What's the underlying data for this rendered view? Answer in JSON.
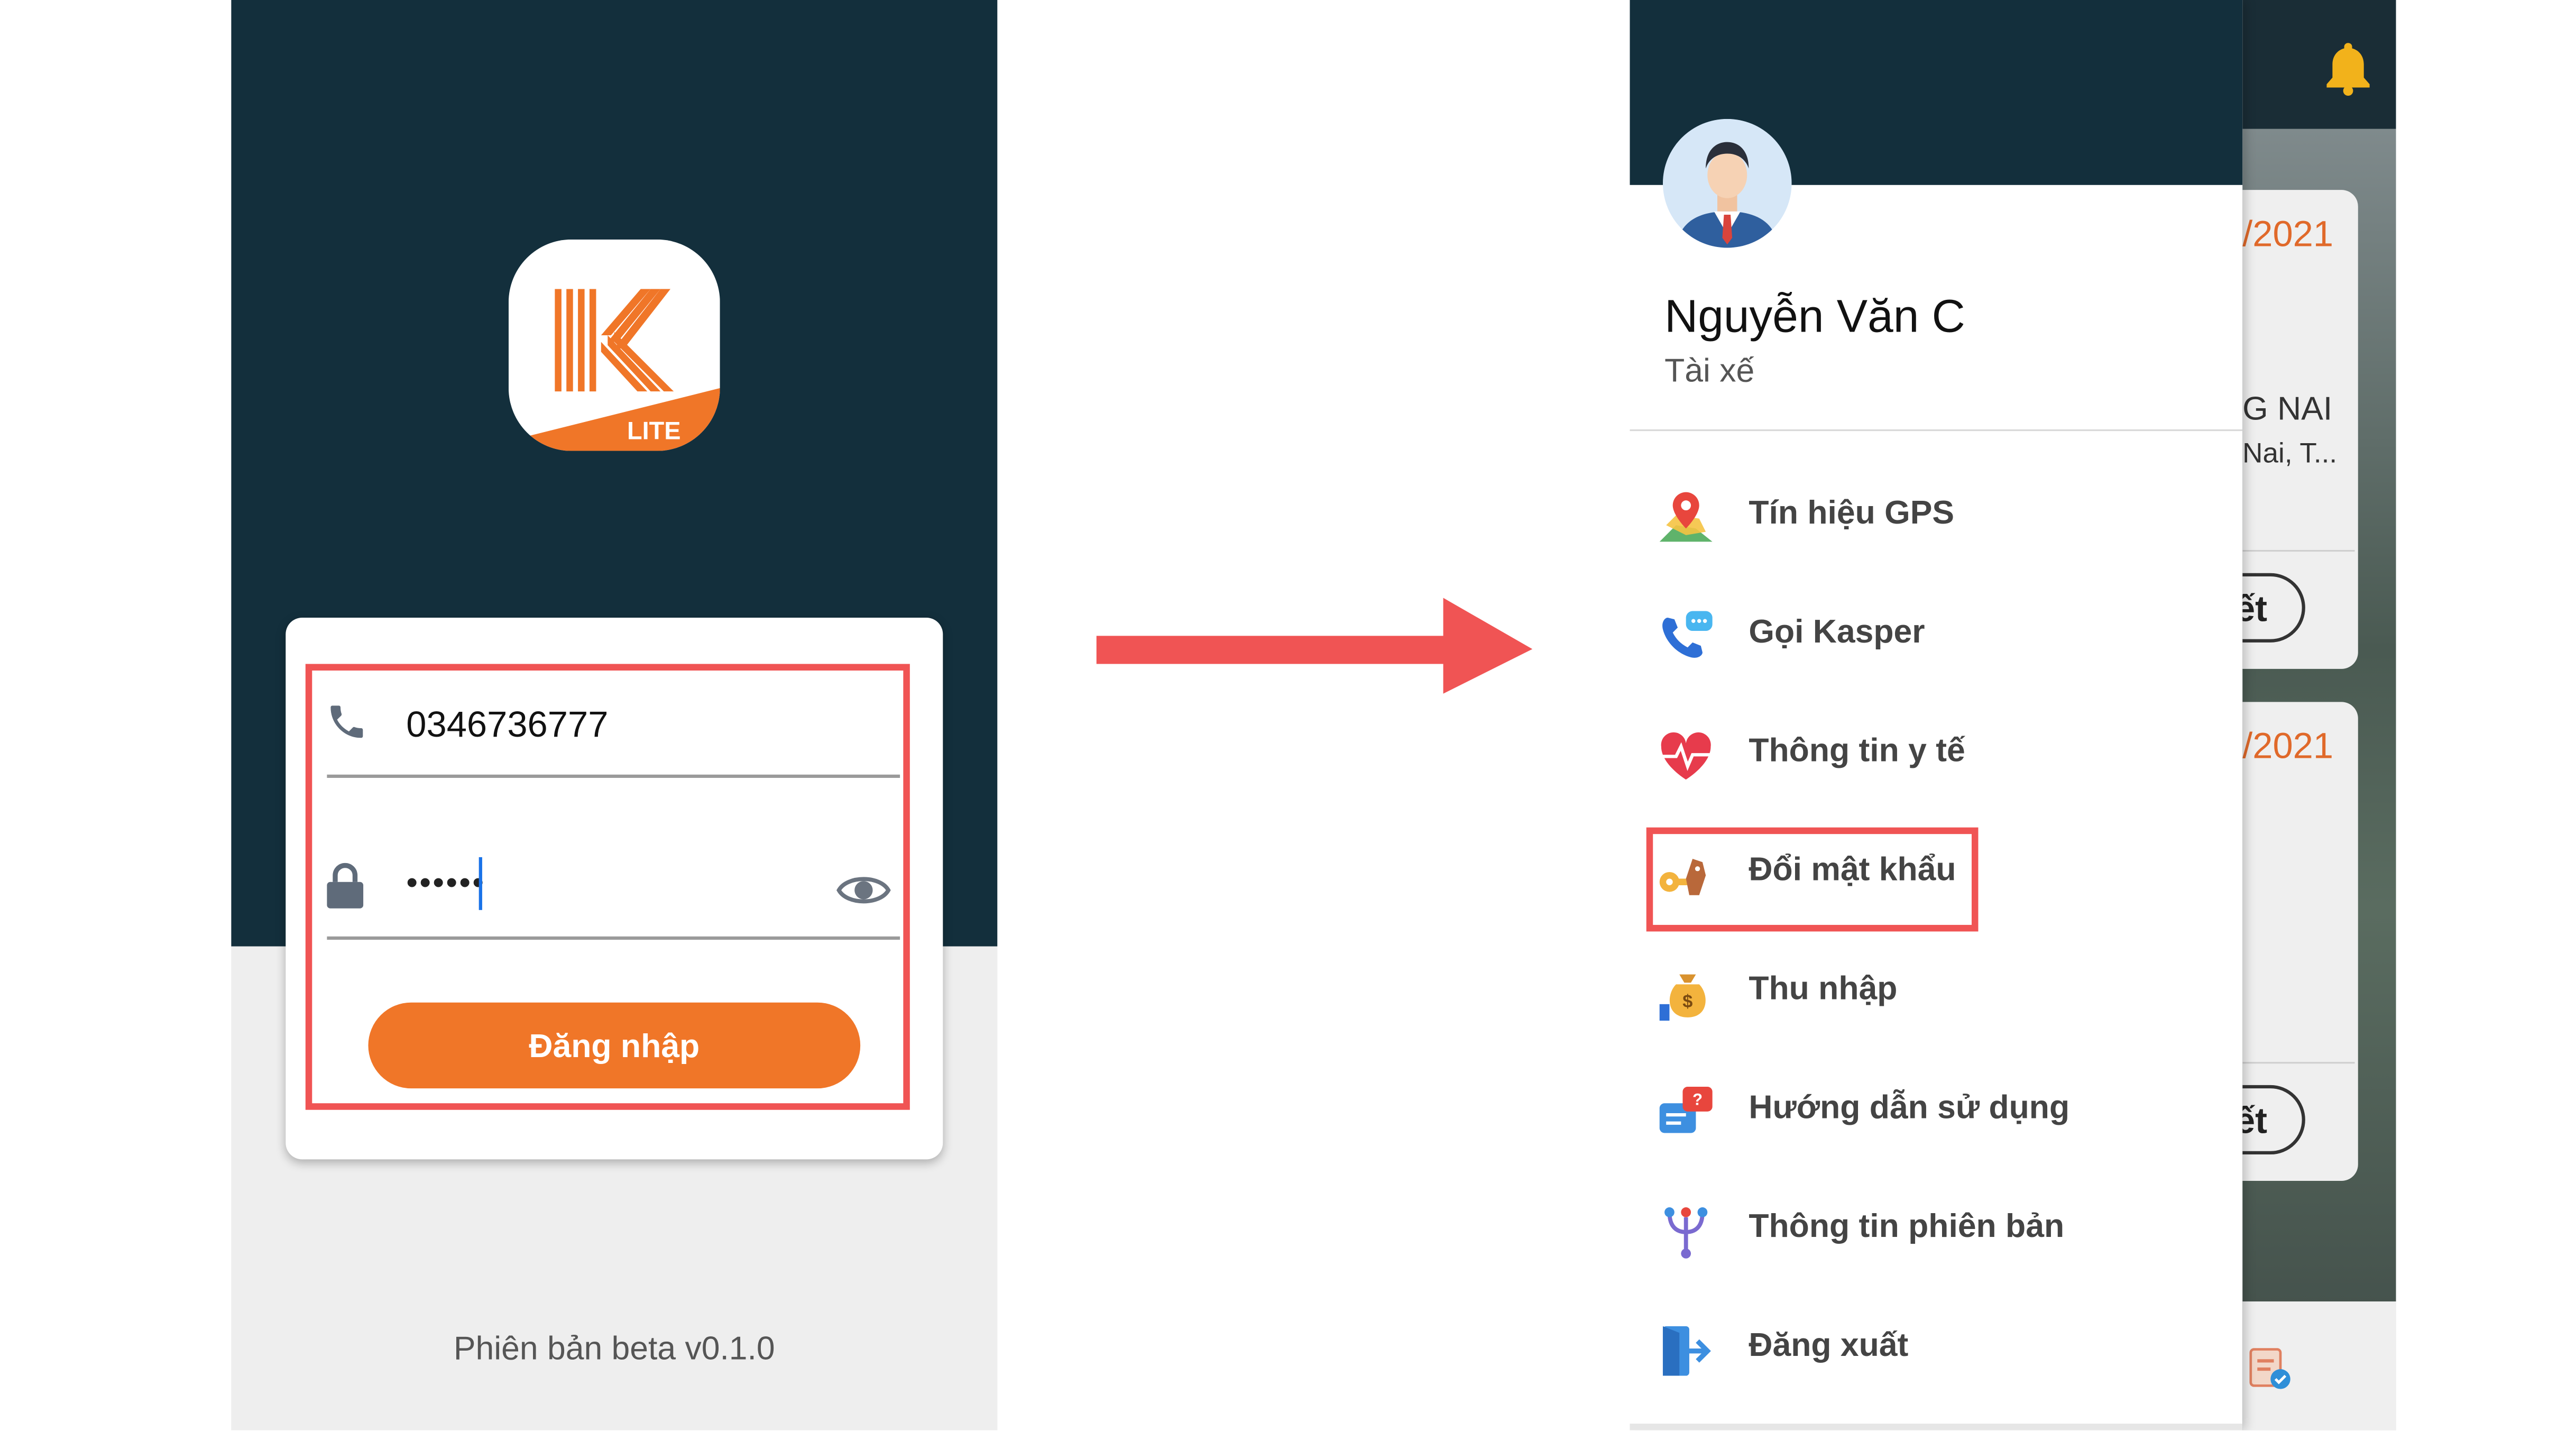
{
  "login": {
    "phone_value": "0346736777",
    "password_masked": "••••••",
    "button_label": "Đăng nhập",
    "version": "Phiên bản beta v0.1.0",
    "logo_text": "LITE"
  },
  "menu": {
    "user_name": "Nguyễn Văn C",
    "user_role": "Tài xế",
    "items": [
      {
        "label": "Tín hiệu GPS",
        "icon": "map-pin-icon"
      },
      {
        "label": "Gọi Kasper",
        "icon": "phone-chat-icon"
      },
      {
        "label": "Thông tin y tế",
        "icon": "heart-pulse-icon"
      },
      {
        "label": "Đổi mật khẩu",
        "icon": "key-icon"
      },
      {
        "label": "Thu nhập",
        "icon": "money-bag-icon"
      },
      {
        "label": "Hướng dẫn sử dụng",
        "icon": "help-chat-icon"
      },
      {
        "label": "Thông tin phiên bản",
        "icon": "version-fork-icon"
      },
      {
        "label": "Đăng xuất",
        "icon": "logout-icon"
      }
    ],
    "highlighted_item": "Đổi mật khẩu"
  },
  "background_app": {
    "date_1": "/2021",
    "date_2": "/2021",
    "location_1": "G NAI",
    "location_2": "Nai, T...",
    "detail_button_1": "tiết",
    "detail_button_2": "tiết"
  },
  "colors": {
    "header_dark": "#132f3c",
    "accent_orange": "#f07628",
    "highlight_red": "#f05454"
  }
}
